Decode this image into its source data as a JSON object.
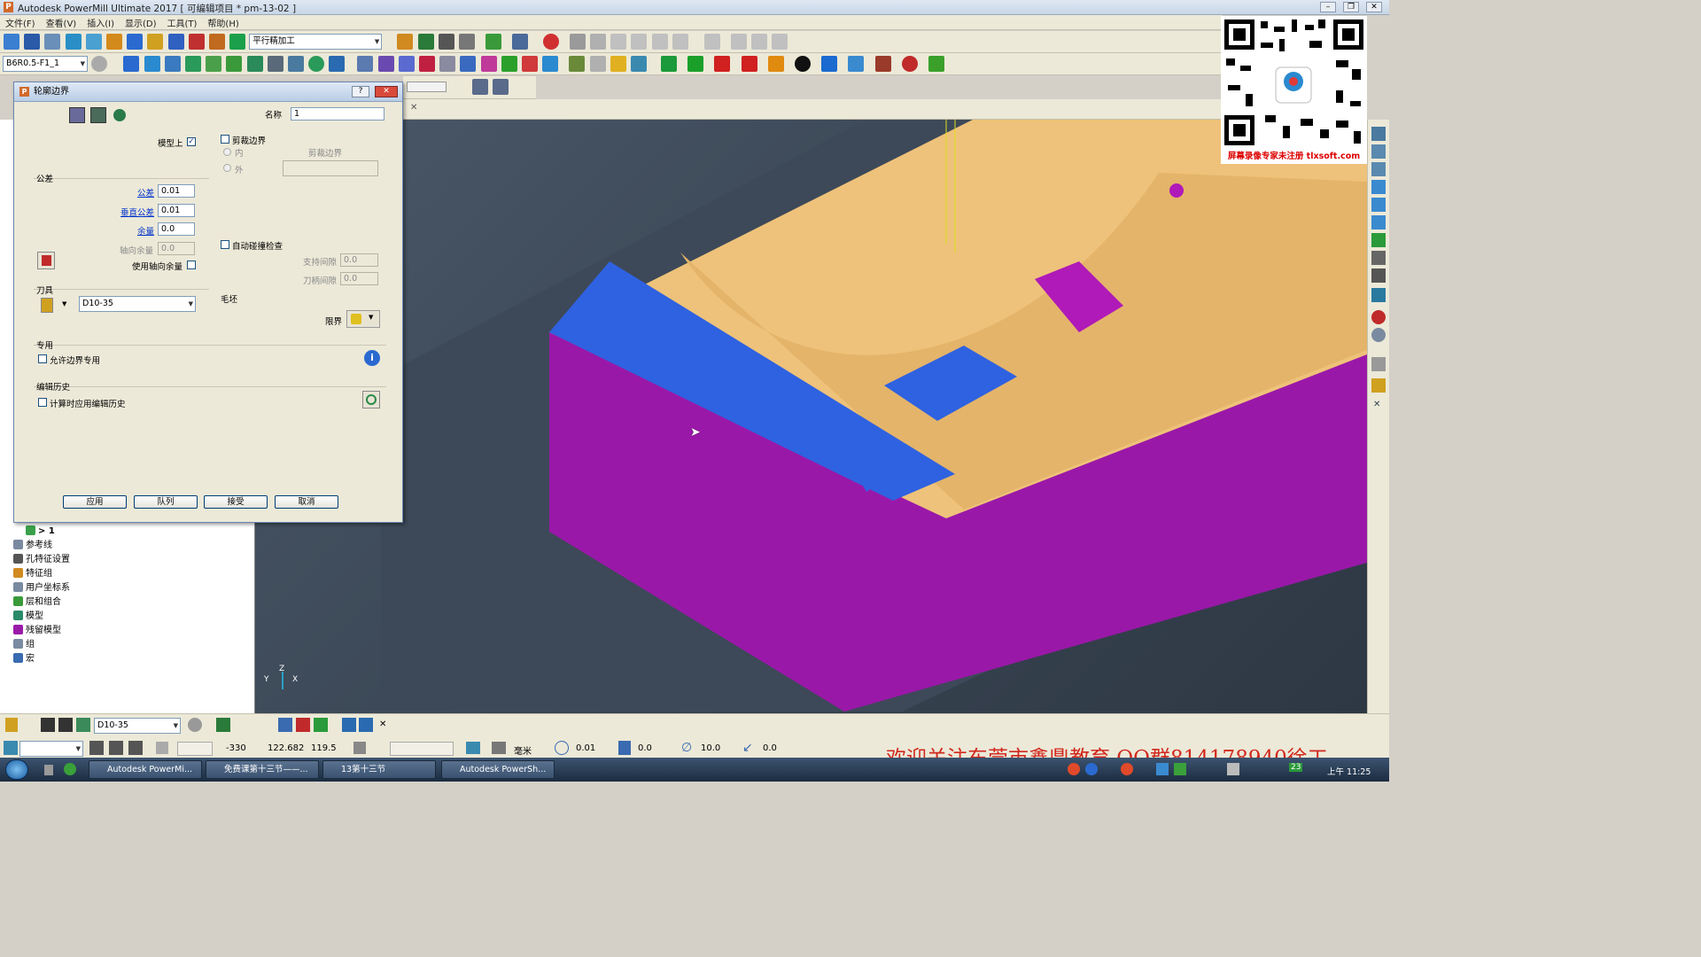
{
  "window": {
    "title": "Autodesk PowerMill Ultimate 2017    [ 可编辑项目 * pm-13-02 ]"
  },
  "menu": [
    "文件(F)",
    "查看(V)",
    "插入(I)",
    "显示(D)",
    "工具(T)",
    "帮助(H)"
  ],
  "toolbar": {
    "strategy_combo": "平行精加工",
    "toolpath_combo": "B6R0.5-F1_1"
  },
  "dialog": {
    "title": "轮廓边界",
    "help": "?",
    "close": "✕",
    "name_label": "名称",
    "name_value": "1",
    "on_model_label": "模型上",
    "on_model_checked": "✓",
    "trim_label": "剪裁边界",
    "trim_inner": "内",
    "trim_outer": "外",
    "trim_boundary_label": "剪裁边界",
    "tolerance_group": "公差",
    "tolerance_label": "公差",
    "tolerance_value": "0.01",
    "vertical_tol_label": "垂直公差",
    "vertical_tol_value": "0.01",
    "allowance_label": "余量",
    "allowance_value": "0.0",
    "axial_allowance_label": "轴向余量",
    "axial_allowance_value": "0.0",
    "use_axial_label": "使用轴向余量",
    "auto_collision_label": "自动碰撞检查",
    "holder_clearance_label": "支持间隙",
    "holder_clearance_value": "0.0",
    "shank_clearance_label": "刀柄间隙",
    "shank_clearance_value": "0.0",
    "tool_group": "刀具",
    "tool_value": "D10-35",
    "stock_group": "毛坯",
    "limit_label": "限界",
    "private_group": "专用",
    "allow_private_label": "允许边界专用",
    "history_group": "编辑历史",
    "apply_history_label": "计算时应用编辑历史",
    "buttons": {
      "apply": "应用",
      "queue": "队列",
      "accept": "接受",
      "cancel": "取消"
    }
  },
  "tree": [
    {
      "label": "> 1"
    },
    {
      "label": "参考线"
    },
    {
      "label": "孔特征设置"
    },
    {
      "label": "特征组"
    },
    {
      "label": "用户坐标系"
    },
    {
      "label": "层和组合"
    },
    {
      "label": "模型"
    },
    {
      "label": "残留模型"
    },
    {
      "label": "组"
    },
    {
      "label": "宏"
    }
  ],
  "status": {
    "tool": "D10-35",
    "x": "-330",
    "y": "122.682",
    "z": "119.5",
    "units": "毫米",
    "tol": "0.01",
    "thickness": "0.0",
    "stepover": "10.0",
    "angle": "0.0"
  },
  "axis_labels": {
    "y": "Y",
    "z": "Z",
    "x": "X"
  },
  "watermark": {
    "qr_caption": "屏幕录像专家未注册 tlxsoft.com",
    "banner": "欢迎关注东莞市鑫鼎教育 QQ群814178940徐工"
  },
  "taskbar": {
    "items": [
      "Autodesk PowerMi...",
      "免费课第十三节——...",
      "13第十三节",
      "Autodesk PowerSh..."
    ],
    "clock": "上午 11:25",
    "num": "23"
  },
  "colors": {
    "model_top": "#eec27a",
    "model_side": "#9a18a8",
    "flat": "#2f62e0",
    "viewport": "#3a4654"
  }
}
